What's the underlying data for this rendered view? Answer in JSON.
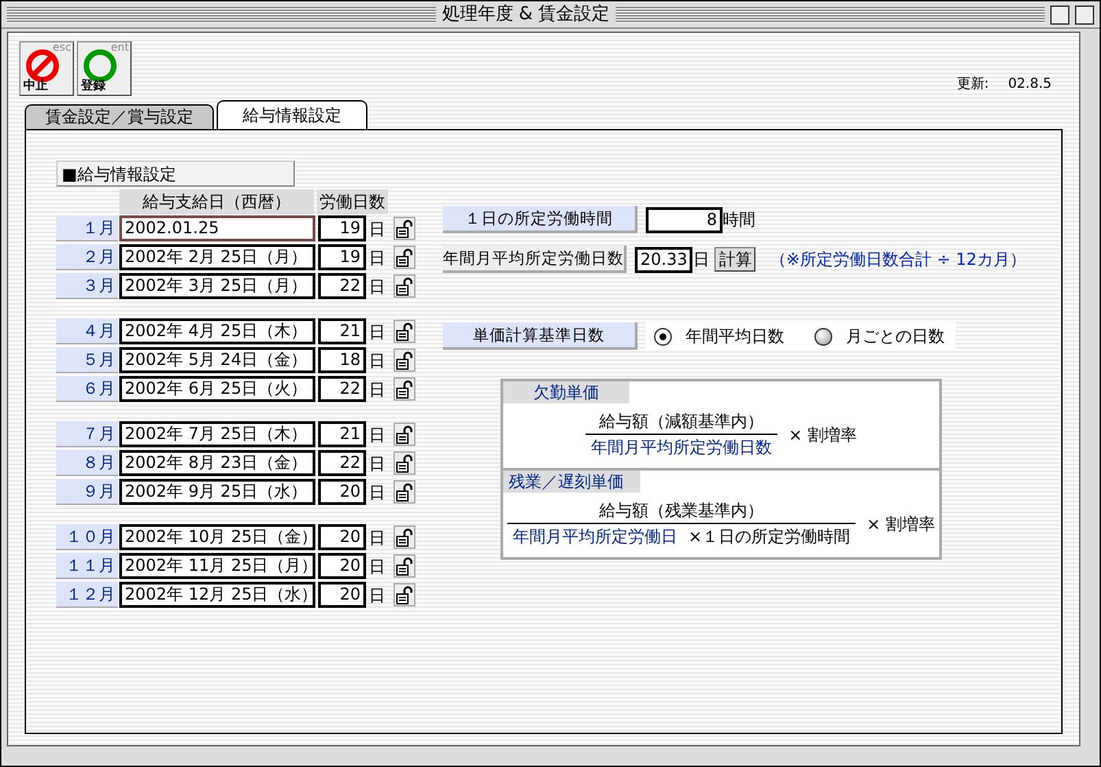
{
  "window": {
    "title": "処理年度 & 賃金設定"
  },
  "toolbar": [
    {
      "kind": "cancel",
      "label": "中止",
      "shortcut": "esc"
    },
    {
      "kind": "ok",
      "label": "登録",
      "shortcut": "ent"
    }
  ],
  "update": {
    "label": "更新:",
    "value": "02.8.5"
  },
  "tabs": [
    {
      "label": "賃金設定／賞与設定",
      "selected": false
    },
    {
      "label": "給与情報設定",
      "selected": true
    }
  ],
  "section_title": "■給与情報設定",
  "columns": [
    "給与支給日（西暦）",
    "労働日数"
  ],
  "month_groups": [
    [
      {
        "month": "１月",
        "date": "2002.01.25",
        "days": "19",
        "unit": "日",
        "focused": true
      },
      {
        "month": "２月",
        "date": "2002年 2月 25日（月）",
        "days": "19",
        "unit": "日",
        "focused": false
      },
      {
        "month": "３月",
        "date": "2002年 3月 25日（月）",
        "days": "22",
        "unit": "日",
        "focused": false
      }
    ],
    [
      {
        "month": "４月",
        "date": "2002年 4月 25日（木）",
        "days": "21",
        "unit": "日",
        "focused": false
      },
      {
        "month": "５月",
        "date": "2002年 5月 24日（金）",
        "days": "18",
        "unit": "日",
        "focused": false
      },
      {
        "month": "６月",
        "date": "2002年 6月 25日（火）",
        "days": "22",
        "unit": "日",
        "focused": false
      }
    ],
    [
      {
        "month": "７月",
        "date": "2002年 7月 25日（木）",
        "days": "21",
        "unit": "日",
        "focused": false
      },
      {
        "month": "８月",
        "date": "2002年 8月 23日（金）",
        "days": "22",
        "unit": "日",
        "focused": false
      },
      {
        "month": "９月",
        "date": "2002年 9月 25日（水）",
        "days": "20",
        "unit": "日",
        "focused": false
      }
    ],
    [
      {
        "month": "１０月",
        "date": "2002年 10月 25日（金）",
        "days": "20",
        "unit": "日",
        "focused": false
      },
      {
        "month": "１１月",
        "date": "2002年 11月 25日（月）",
        "days": "20",
        "unit": "日",
        "focused": false
      },
      {
        "month": "１２月",
        "date": "2002年 12月 25日（水）",
        "days": "20",
        "unit": "日",
        "focused": false
      }
    ]
  ],
  "daily_hours": {
    "label": "１日の所定労働時間",
    "value": "8",
    "unit": "時間"
  },
  "monthly_days": {
    "label": "年間月平均所定労働日数",
    "value": "20.33",
    "unit": "日",
    "button": "計算",
    "note": "（※所定労働日数合計 ÷ 12カ月）"
  },
  "basis": {
    "label": "単価計算基準日数",
    "options": [
      {
        "label": "年間平均日数",
        "selected": true
      },
      {
        "label": "月ごとの日数",
        "selected": false
      }
    ]
  },
  "formulas": [
    {
      "title": "欠勤単価",
      "numerator": "給与額（減額基準内）",
      "denominator": "年間月平均所定労働日数",
      "multiplier": "× 割増率"
    },
    {
      "title": "残業／遅刻単価",
      "numerator": "給与額（残業基準内）",
      "denominator": "年間月平均所定労働日",
      "denominator_factor": "×１日の所定労働時間",
      "multiplier": "× 割増率"
    }
  ]
}
